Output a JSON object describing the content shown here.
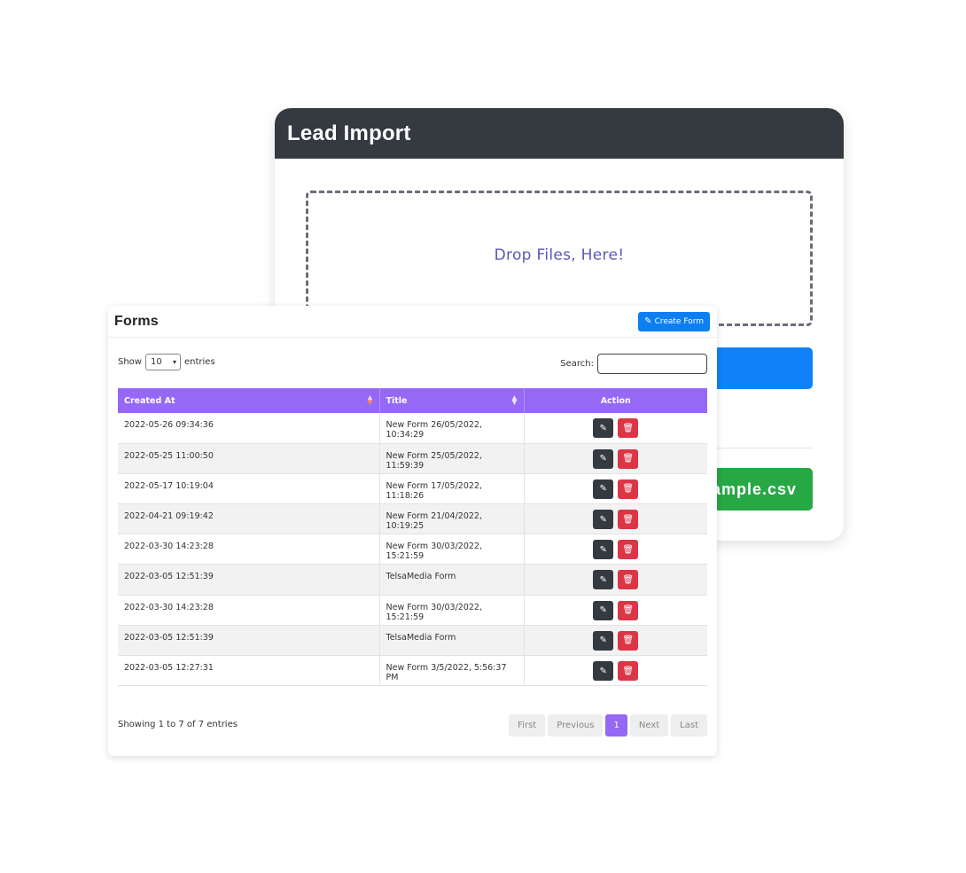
{
  "lead_import": {
    "title": "Lead Import",
    "dropzone_text": "Drop Files, Here!",
    "sample_button": "ample.csv"
  },
  "forms": {
    "title": "Forms",
    "create_button": "Create Form",
    "show_label": "Show",
    "entries_label": "entries",
    "entries_value": "10",
    "search_label": "Search:",
    "columns": [
      "Created At",
      "Title",
      "Action"
    ],
    "rows": [
      {
        "created": "2022-05-26 09:34:36",
        "title": "New Form 26/05/2022, 10:34:29"
      },
      {
        "created": "2022-05-25 11:00:50",
        "title": "New Form 25/05/2022, 11:59:39"
      },
      {
        "created": "2022-05-17 10:19:04",
        "title": "New Form 17/05/2022, 11:18:26"
      },
      {
        "created": "2022-04-21 09:19:42",
        "title": "New Form 21/04/2022, 10:19:25"
      },
      {
        "created": "2022-03-30 14:23:28",
        "title": "New Form 30/03/2022, 15:21:59"
      },
      {
        "created": "2022-03-05 12:51:39",
        "title": "TelsaMedia Form"
      },
      {
        "created": "2022-03-30 14:23:28",
        "title": "New Form 30/03/2022, 15:21:59"
      },
      {
        "created": "2022-03-05 12:51:39",
        "title": "TelsaMedia Form"
      },
      {
        "created": "2022-03-05 12:27:31",
        "title": "New Form 3/5/2022, 5:56:37 PM"
      }
    ],
    "showing_text": "Showing 1 to 7 of 7 entries",
    "pagination": {
      "first": "First",
      "previous": "Previous",
      "current": "1",
      "next": "Next",
      "last": "Last"
    }
  },
  "colors": {
    "header_dark": "#343a40",
    "table_header": "#9568f5",
    "primary": "#1081f7",
    "success": "#28a745",
    "danger": "#dc3545"
  }
}
